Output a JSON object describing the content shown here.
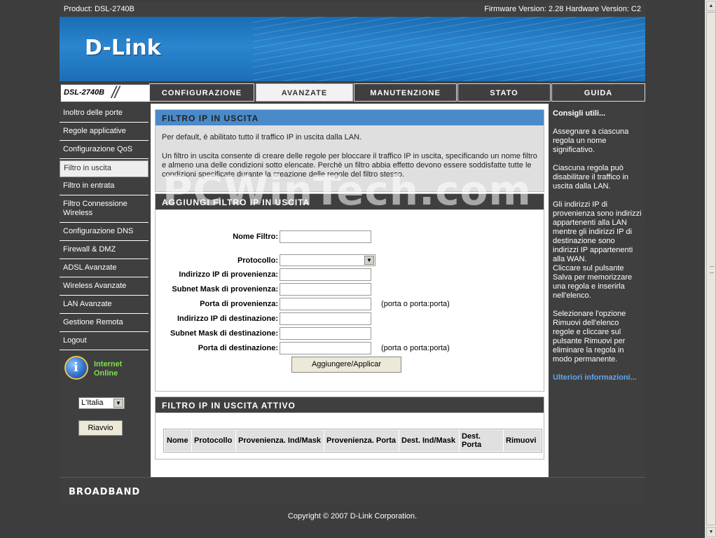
{
  "header": {
    "product": "Product: DSL-2740B",
    "firmware": "Firmware Version: 2.28 Hardware Version: C2",
    "logo": "D-Link"
  },
  "nav": {
    "model": "DSL-2740B",
    "tabs": [
      {
        "label": "CONFIGURAZIONE",
        "active": false
      },
      {
        "label": "AVANZATE",
        "active": true
      },
      {
        "label": "MANUTENZIONE",
        "active": false
      },
      {
        "label": "STATO",
        "active": false
      },
      {
        "label": "GUIDA",
        "active": false
      }
    ]
  },
  "sidebar": {
    "items": [
      {
        "label": "Inoltro delle porte"
      },
      {
        "label": "Regole applicative"
      },
      {
        "label": "Configurazione QoS"
      },
      {
        "label": "Filtro in uscita",
        "active": true
      },
      {
        "label": "Filtro in entrata"
      },
      {
        "label": "Filtro Connessione Wireless"
      },
      {
        "label": "Configurazione DNS"
      },
      {
        "label": "Firewall & DMZ"
      },
      {
        "label": "ADSL Avanzate"
      },
      {
        "label": "Wireless Avanzate"
      },
      {
        "label": "LAN Avanzate"
      },
      {
        "label": "Gestione Remota"
      },
      {
        "label": "Logout"
      }
    ],
    "status_line1": "Internet",
    "status_line2": "Online",
    "language": "L'Italia",
    "reboot_label": "Riavvio"
  },
  "main": {
    "section1": {
      "title": "FILTRO IP IN USCITA",
      "para1": "Per default, è abilitato tutto il traffico IP in uscita dalla LAN.",
      "para2": "Un filtro in uscita consente di creare delle regole per bloccare il traffico IP in uscita, specificando un nome filtro e almeno una delle condizioni sotto elencate. Perchè un filtro abbia effetto devono essere soddisfatte tutte le condizioni specificate durante la creazione delle regole del filtro stesso."
    },
    "section2": {
      "title": "AGGIUNGI FILTRO IP IN USCITA",
      "fields": {
        "name_label": "Nome Filtro:",
        "name_value": "",
        "protocol_label": "Protocollo:",
        "protocol_value": "",
        "src_ip_label": "Indirizzo IP di provenienza:",
        "src_ip_value": "",
        "src_mask_label": "Subnet Mask di provenienza:",
        "src_mask_value": "",
        "src_port_label": "Porta di provenienza:",
        "src_port_value": "",
        "src_port_hint": "(porta o porta:porta)",
        "dst_ip_label": "Indirizzo IP di destinazione:",
        "dst_ip_value": "",
        "dst_mask_label": "Subnet Mask di destinazione:",
        "dst_mask_value": "",
        "dst_port_label": "Porta di destinazione:",
        "dst_port_value": "",
        "dst_port_hint": "(porta o porta:porta)"
      },
      "apply_label": "Aggiungere/Applicar"
    },
    "section3": {
      "title": "FILTRO IP IN USCITA ATTIVO",
      "columns": [
        "Nome",
        "Protocollo",
        "Provenienza. Ind/Mask",
        "Provenienza. Porta",
        "Dest. Ind/Mask",
        "Dest. Porta",
        "Rimuovi"
      ]
    }
  },
  "tips": {
    "title": "Consigli utili...",
    "paragraphs": [
      "Assegnare a ciascuna regola un nome significativo.",
      "Ciascuna regola può disabilitare il traffico in uscita dalla LAN.",
      "Gli indirizzi IP di provenienza sono indirizzi appartenenti alla LAN mentre gli indirizzi IP di destinazione sono indirizzi IP appartenenti alla WAN.",
      "Cliccare sul pulsante Salva per memorizzare una regola e inserirla nell'elenco.",
      "Selezionare l'opzione Rimuovi dell'elenco regole e cliccare sul pulsante Rimuovi per eliminare la regola in modo permanente."
    ],
    "more": "Ulteriori informazioni..."
  },
  "footer": {
    "brand": "BROADBAND",
    "copyright": "Copyright © 2007 D-Link Corporation."
  },
  "watermark": "PCWinTech.com"
}
